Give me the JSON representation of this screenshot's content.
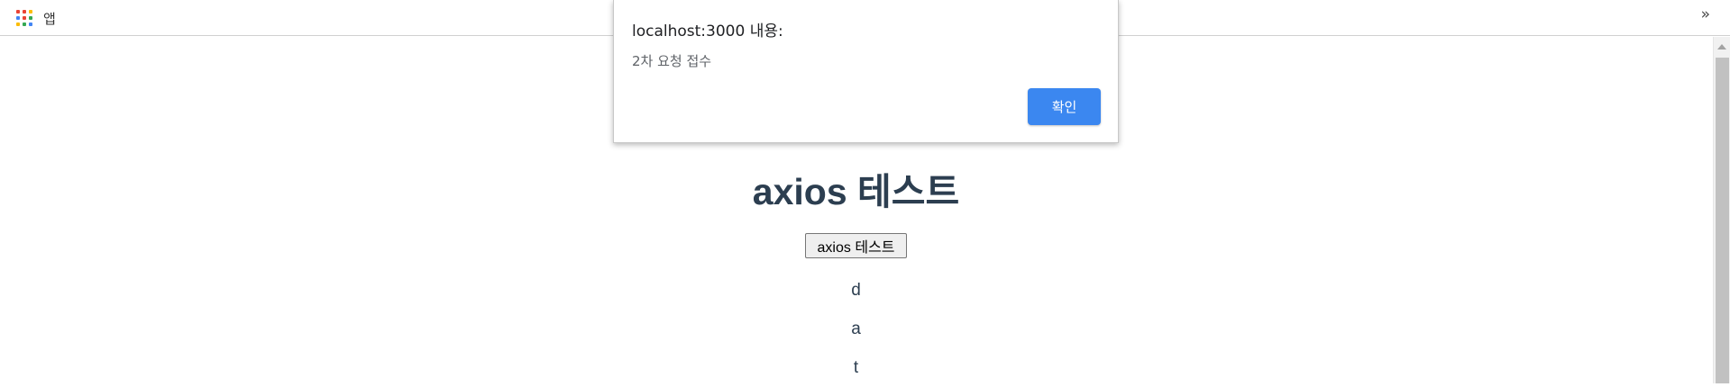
{
  "bookmarks_bar": {
    "apps_label": "앱",
    "overflow_icon": "chevron-double-right-icon",
    "apps_icon_colors": [
      "#ea4335",
      "#ea4335",
      "#fbbc05",
      "#4285f4",
      "#ea4335",
      "#34a853",
      "#fbbc05",
      "#34a853",
      "#4285f4"
    ]
  },
  "dialog": {
    "title": "localhost:3000 내용:",
    "message": "2차 요청 접수",
    "ok_label": "확인",
    "ok_color": "#3b87f0"
  },
  "page": {
    "title": "axios 테스트",
    "button_label": "axios 테스트",
    "items": [
      "d",
      "a",
      "t"
    ],
    "text_color": "#2c3e50"
  }
}
